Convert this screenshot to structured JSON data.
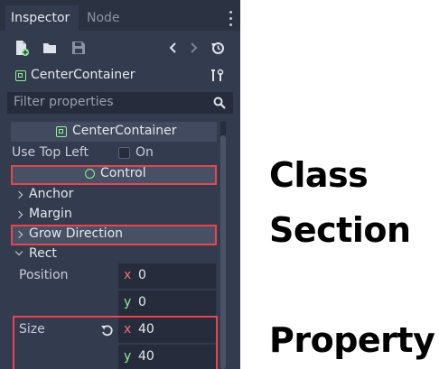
{
  "tabs": {
    "inspector": "Inspector",
    "node": "Node"
  },
  "object": {
    "name": "CenterContainer"
  },
  "filter": {
    "placeholder": "Filter properties"
  },
  "section": {
    "class_name": "CenterContainer"
  },
  "properties": {
    "use_top_left": {
      "label": "Use Top Left",
      "value_text": "On",
      "checked": false
    },
    "control_class": "Control",
    "groups": {
      "anchor": "Anchor",
      "margin": "Margin",
      "grow_direction": "Grow Direction",
      "rect": "Rect"
    },
    "position": {
      "label": "Position",
      "x_axis": "x",
      "x": "0",
      "y_axis": "y",
      "y": "0"
    },
    "size": {
      "label": "Size",
      "x_axis": "x",
      "x": "40",
      "y_axis": "y",
      "y": "40"
    }
  },
  "annotations": {
    "class": "Class",
    "section": "Section",
    "property": "Property"
  },
  "colors": {
    "panel": "#333b4f",
    "highlight": "#e5464f",
    "x_axis": "#ee7276",
    "y_axis": "#8eef97"
  }
}
